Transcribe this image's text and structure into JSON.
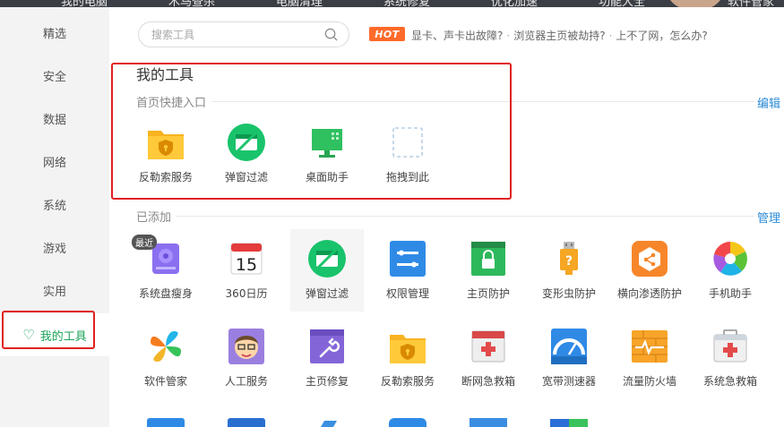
{
  "top_nav": [
    "我的电脑",
    "木马查杀",
    "电脑清理",
    "系统修复",
    "优化加速",
    "功能大全",
    "软件管家"
  ],
  "sidebar": {
    "items": [
      {
        "label": "精选"
      },
      {
        "label": "安全"
      },
      {
        "label": "数据"
      },
      {
        "label": "网络"
      },
      {
        "label": "系统"
      },
      {
        "label": "游戏"
      },
      {
        "label": "实用"
      },
      {
        "label": "我的工具",
        "active": true
      }
    ]
  },
  "search": {
    "placeholder": "搜索工具"
  },
  "hot": {
    "badge": "HOT",
    "links": [
      "显卡、声卡出故障?",
      "浏览器主页被劫持?",
      "上不了网，怎么办?"
    ],
    "separator": "·"
  },
  "my_tools": {
    "title": "我的工具",
    "quick_label": "首页快捷入口",
    "edit_label": "编辑",
    "quick_items": [
      {
        "label": "反勒索服务",
        "icon": "folder-shield-icon"
      },
      {
        "label": "弹窗过滤",
        "icon": "popup-filter-icon"
      },
      {
        "label": "桌面助手",
        "icon": "desktop-assistant-icon"
      },
      {
        "label": "拖拽到此",
        "icon": "drop-placeholder-icon"
      }
    ],
    "added_label": "已添加",
    "manage_label": "管理",
    "recent_badge": "最近",
    "added_items": [
      {
        "label": "系统盘瘦身",
        "icon": "disk-slim-icon"
      },
      {
        "label": "360日历",
        "icon": "calendar-icon",
        "day": "15"
      },
      {
        "label": "弹窗过滤",
        "icon": "popup-filter-icon"
      },
      {
        "label": "权限管理",
        "icon": "permission-icon"
      },
      {
        "label": "主页防护",
        "icon": "homepage-lock-icon"
      },
      {
        "label": "变形虫防护",
        "icon": "usb-question-icon"
      },
      {
        "label": "横向渗透防护",
        "icon": "network-share-icon"
      },
      {
        "label": "手机助手",
        "icon": "phone-assistant-icon"
      },
      {
        "label": "软件管家",
        "icon": "software-manager-icon"
      },
      {
        "label": "人工服务",
        "icon": "human-service-icon"
      },
      {
        "label": "主页修复",
        "icon": "homepage-repair-icon"
      },
      {
        "label": "反勒索服务",
        "icon": "folder-shield-icon"
      },
      {
        "label": "断网急救箱",
        "icon": "network-firstaid-icon"
      },
      {
        "label": "宽带测速器",
        "icon": "speedtest-icon"
      },
      {
        "label": "流量防火墙",
        "icon": "traffic-firewall-icon"
      },
      {
        "label": "系统急救箱",
        "icon": "system-firstaid-icon"
      }
    ]
  },
  "colors": {
    "accent": "#1aa35a",
    "link": "#2a8bd8",
    "highlight_box": "#e02020",
    "hot": "#ff6a2a"
  }
}
